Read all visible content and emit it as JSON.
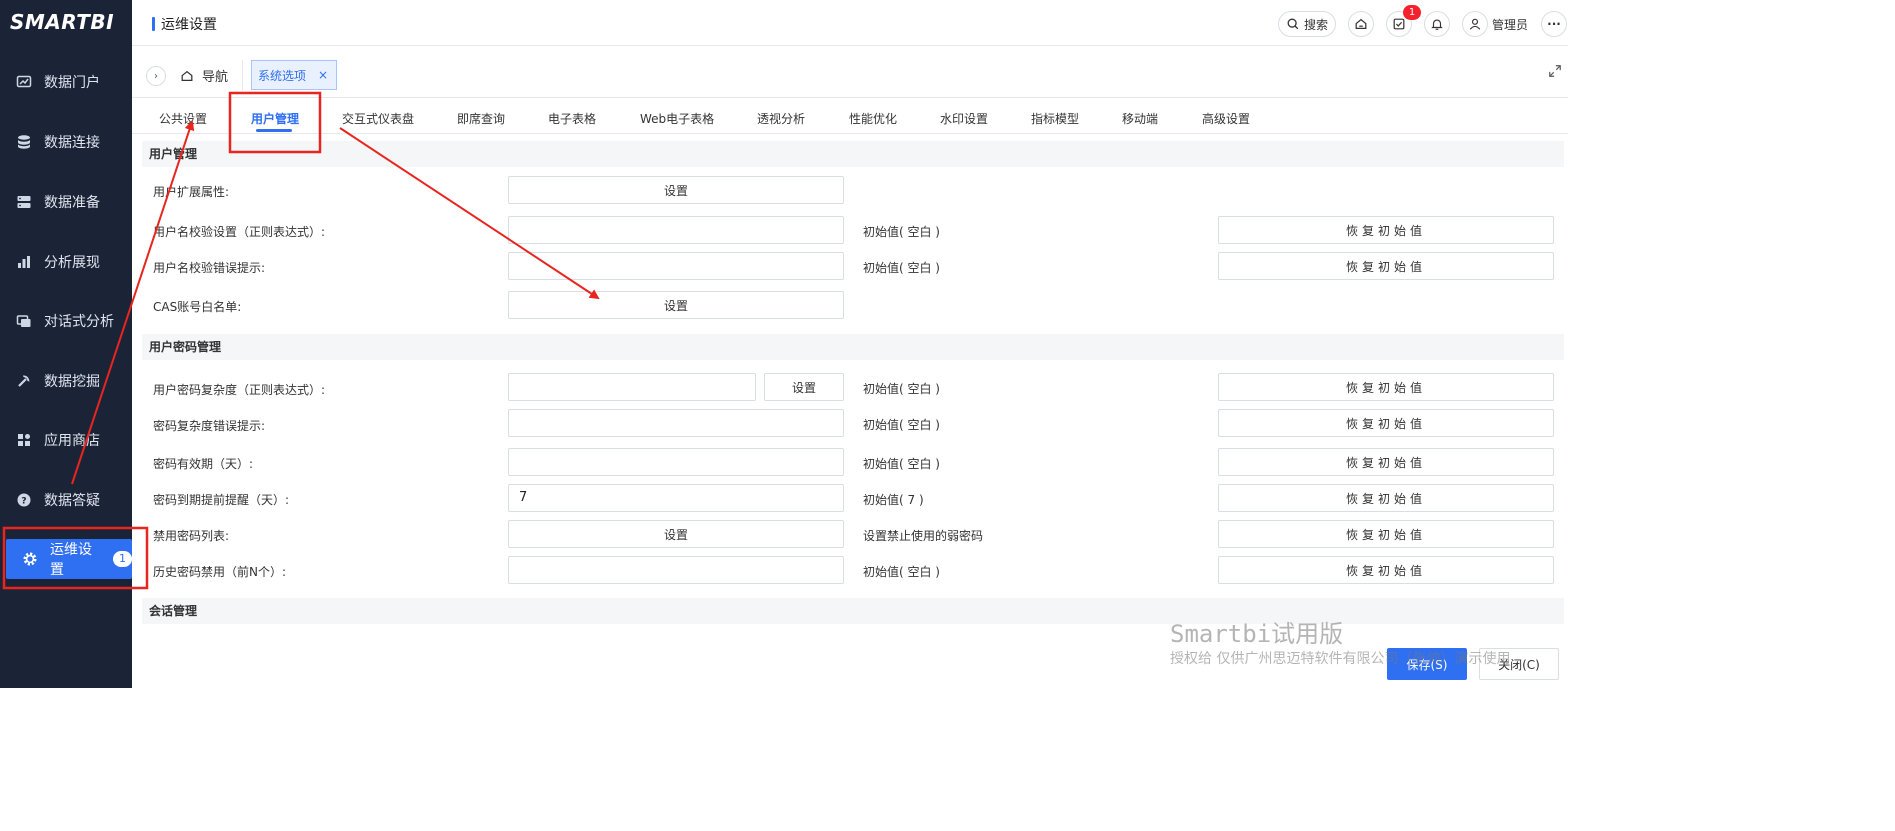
{
  "app": {
    "logo_text": "SMARTBI"
  },
  "sidebar": {
    "items": [
      {
        "label": "数据门户",
        "icon": "chart-icon"
      },
      {
        "label": "数据连接",
        "icon": "database-icon"
      },
      {
        "label": "数据准备",
        "icon": "server-icon"
      },
      {
        "label": "分析展现",
        "icon": "bar-chart-icon"
      },
      {
        "label": "对话式分析",
        "icon": "chat-icon"
      },
      {
        "label": "数据挖掘",
        "icon": "pickaxe-icon"
      },
      {
        "label": "应用商店",
        "icon": "grid-icon"
      },
      {
        "label": "数据答疑",
        "icon": "question-icon"
      },
      {
        "label": "运维设置",
        "icon": "gear-icon",
        "badge": "1",
        "active": true
      }
    ]
  },
  "header": {
    "title": "运维设置",
    "search_label": "搜索",
    "task_badge": "1",
    "user_name": "管理员",
    "more": "···"
  },
  "tabs": {
    "collapse": "›",
    "nav_label": "导航",
    "open_tab": "系统选项",
    "close": "×"
  },
  "settings_tabs": [
    "公共设置",
    "用户管理",
    "交互式仪表盘",
    "即席查询",
    "电子表格",
    "Web电子表格",
    "透视分析",
    "性能优化",
    "水印设置",
    "指标模型",
    "移动端",
    "高级设置"
  ],
  "active_settings_tab": "用户管理",
  "sections": {
    "user": {
      "title": "用户管理",
      "rows": [
        {
          "label": "用户扩展属性:",
          "button": "设置"
        },
        {
          "label": "用户名校验设置（正则表达式）:",
          "value": "",
          "init": "初始值( 空白 )",
          "reset": "恢复初始值"
        },
        {
          "label": "用户名校验错误提示:",
          "value": "",
          "init": "初始值( 空白 )",
          "reset": "恢复初始值"
        },
        {
          "label": "CAS账号白名单:",
          "button": "设置"
        }
      ]
    },
    "password": {
      "title": "用户密码管理",
      "rows": [
        {
          "label": "用户密码复杂度（正则表达式）:",
          "value": "",
          "button": "设置",
          "init": "初始值( 空白 )",
          "reset": "恢复初始值"
        },
        {
          "label": "密码复杂度错误提示:",
          "value": "",
          "init": "初始值( 空白 )",
          "reset": "恢复初始值"
        },
        {
          "label": "密码有效期（天）:",
          "value": "",
          "init": "初始值( 空白 )",
          "reset": "恢复初始值"
        },
        {
          "label": "密码到期提前提醒（天）:",
          "value": "7",
          "init": "初始值( 7 )",
          "reset": "恢复初始值"
        },
        {
          "label": "禁用密码列表:",
          "button": "设置",
          "init": "设置禁止使用的弱密码",
          "reset": "恢复初始值"
        },
        {
          "label": "历史密码禁用（前N个）:",
          "value": "",
          "init": "初始值( 空白 )",
          "reset": "恢复初始值"
        }
      ]
    },
    "session": {
      "title": "会话管理"
    }
  },
  "footer": {
    "save": "保存(S)",
    "close": "关闭(C)",
    "watermark_title": "Smartbi试用版",
    "watermark_sub": "授权给 仅供广州思迈特软件有限公司（张帅）演示使用"
  },
  "annotation_color": "#e8251f"
}
